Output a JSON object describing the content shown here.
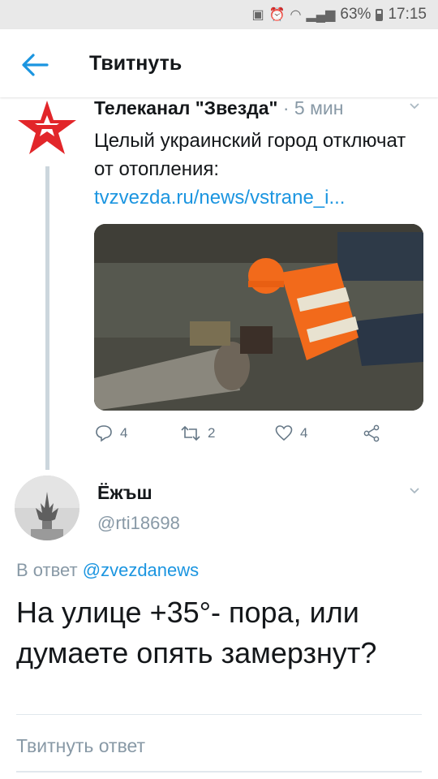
{
  "status_bar": {
    "battery": "63%",
    "time": "17:15"
  },
  "header": {
    "title": "Твитнуть"
  },
  "tweet": {
    "author_name": "Телеканал \"Звезда\"",
    "separator": " · ",
    "time": "5 мин",
    "text": "Целый украинский город отключат от отопления:",
    "link": "tvzvezda.ru/news/vstrane_i...",
    "counts": {
      "replies": "4",
      "retweets": "2",
      "likes": "4"
    }
  },
  "reply": {
    "author_name": "Ёжъш",
    "handle": "@rti18698",
    "in_reply_prefix": "В ответ ",
    "in_reply_mention": "@zvezdanews",
    "text": "На улице +35°- пора, или думаете опять замерзнут?"
  },
  "compose": {
    "placeholder": "Твитнуть ответ"
  },
  "colors": {
    "accent": "#1b95e0",
    "muted": "#8899a6",
    "text": "#14171a",
    "zvezda_red": "#e2262a"
  }
}
